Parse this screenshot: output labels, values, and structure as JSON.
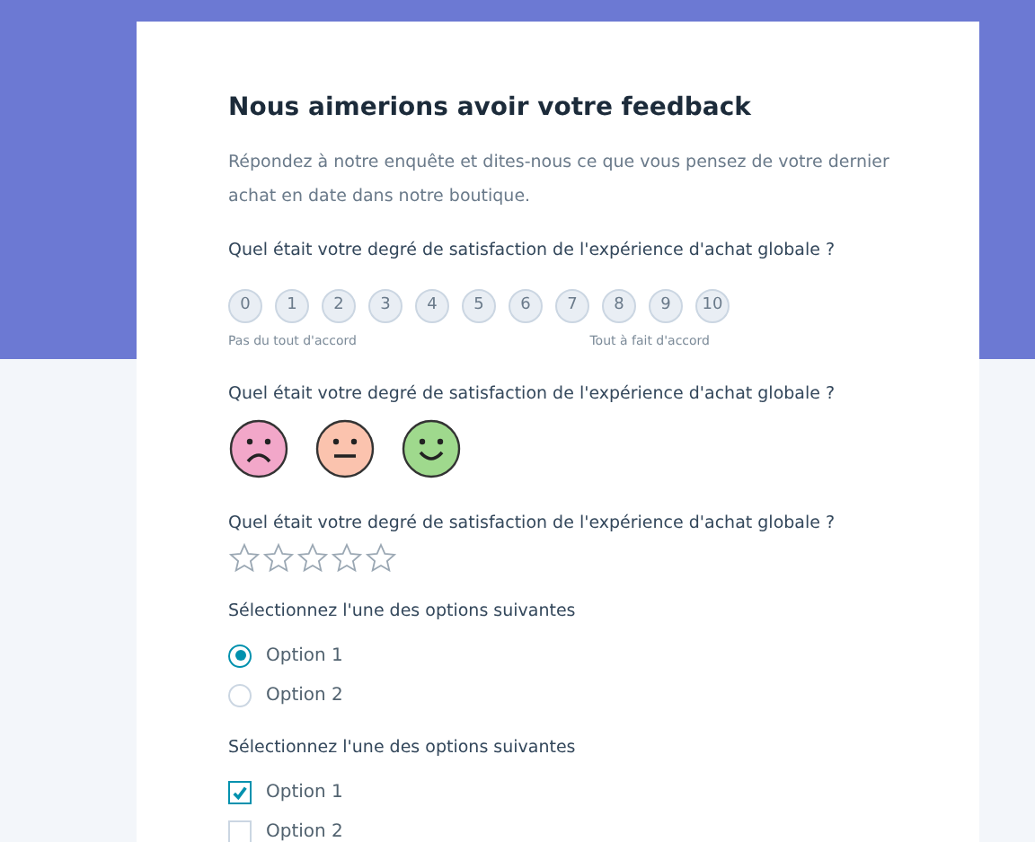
{
  "form": {
    "title": "Nous aimerions avoir votre feedback",
    "description": "Répondez à notre enquête et dites-nous ce que vous pensez de votre dernier achat en date dans notre boutique.",
    "questions": [
      {
        "kind": "scale",
        "label": "Quel était votre degré de satisfaction de l'expérience d'achat globale ?",
        "options": [
          {
            "label": "0",
            "selected": false
          },
          {
            "label": "1",
            "selected": false
          },
          {
            "label": "2",
            "selected": false
          },
          {
            "label": "3",
            "selected": false
          },
          {
            "label": "4",
            "selected": false
          },
          {
            "label": "5",
            "selected": false
          },
          {
            "label": "6",
            "selected": false
          },
          {
            "label": "7",
            "selected": false
          },
          {
            "label": "8",
            "selected": false
          },
          {
            "label": "9",
            "selected": false
          },
          {
            "label": "10",
            "selected": false
          }
        ],
        "min_label": "Pas du tout d'accord",
        "max_label": "Tout à fait d'accord"
      },
      {
        "kind": "faces",
        "label": "Quel était votre degré de satisfaction de l'expérience d'achat globale ?",
        "options": [
          {
            "kind": "sad",
            "color": "#f2a7c9",
            "selected": false
          },
          {
            "kind": "neutral",
            "color": "#fbc3ae",
            "selected": false
          },
          {
            "kind": "happy",
            "color": "#9fd98d",
            "selected": false
          }
        ]
      },
      {
        "kind": "stars",
        "label": "Quel était votre degré de satisfaction de l'expérience d'achat globale ?",
        "stars": 0
      },
      {
        "kind": "radio",
        "label": "Sélectionnez l'une des options suivantes",
        "options": [
          {
            "label": "Option 1",
            "selected": true
          },
          {
            "label": "Option 2",
            "selected": false
          }
        ]
      },
      {
        "kind": "checkbox",
        "label": "Sélectionnez l'une des options suivantes",
        "options": [
          {
            "label": "Option 1",
            "checked": true
          },
          {
            "label": "Option 2",
            "checked": false
          }
        ]
      }
    ]
  }
}
